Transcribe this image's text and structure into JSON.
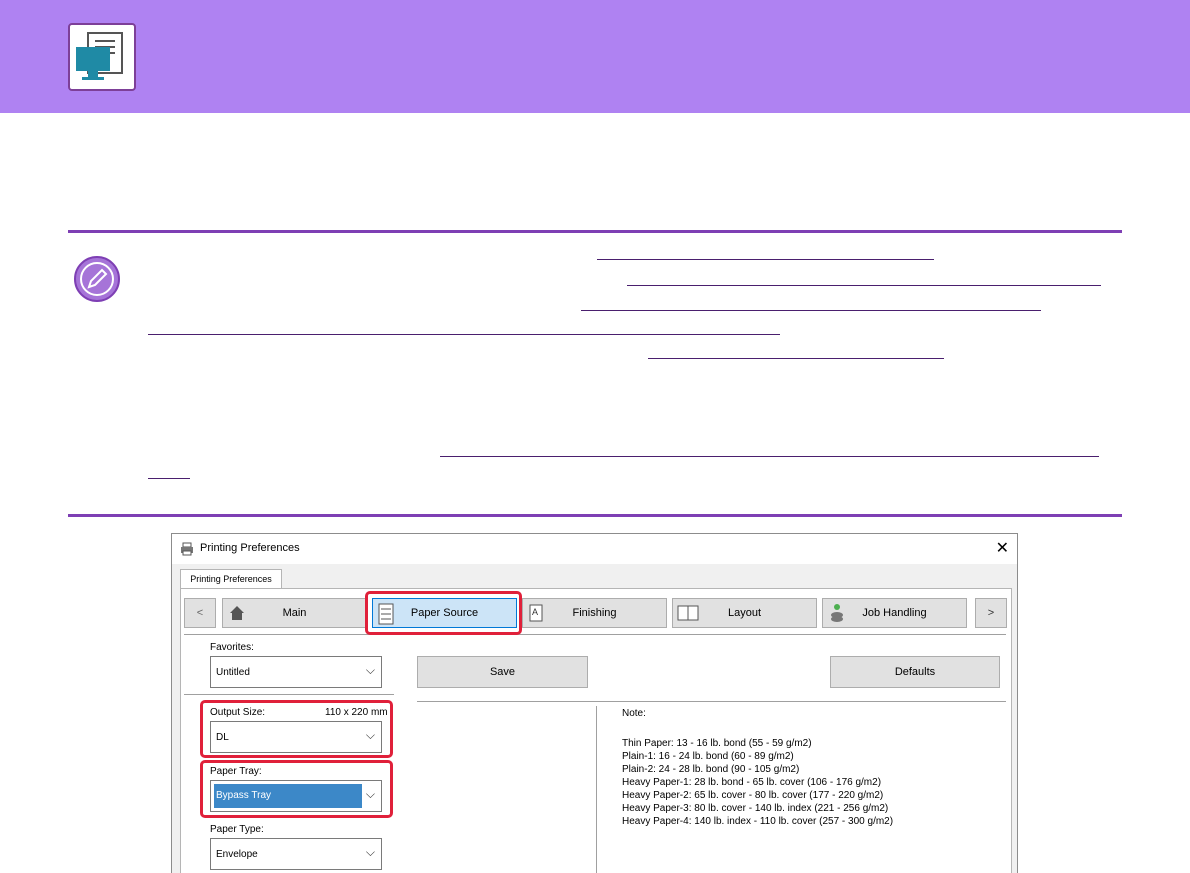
{
  "dialog": {
    "title": "Printing Preferences",
    "close": "✕",
    "tab_label": "Printing Preferences",
    "nav": {
      "prev": "<",
      "next": ">",
      "main": "Main",
      "paper_source": "Paper Source",
      "finishing": "Finishing",
      "layout": "Layout",
      "job_handling": "Job Handling"
    },
    "favorites_label": "Favorites:",
    "favorites_value": "Untitled",
    "save": "Save",
    "defaults": "Defaults",
    "output_size_label": "Output Size:",
    "output_size_dims": "110 x 220 mm",
    "output_size_value": "DL",
    "paper_tray_label": "Paper Tray:",
    "paper_tray_value": "Bypass Tray",
    "paper_type_label": "Paper Type:",
    "paper_type_value": "Envelope",
    "note_title": "Note:",
    "note_lines": [
      "Thin Paper: 13 - 16 lb. bond (55 - 59 g/m2)",
      "Plain-1: 16 - 24 lb. bond (60 - 89 g/m2)",
      "Plain-2: 24 - 28 lb. bond (90 - 105 g/m2)",
      "Heavy Paper-1: 28 lb. bond - 65 lb. cover (106 - 176 g/m2)",
      "Heavy Paper-2: 65 lb. cover - 80 lb. cover (177 - 220 g/m2)",
      "Heavy Paper-3: 80 lb. cover - 140 lb. index (221 - 256 g/m2)",
      "Heavy Paper-4: 140 lb. index - 110 lb. cover (257 - 300 g/m2)"
    ]
  },
  "icons": {
    "banner": "computer-document-icon",
    "note": "pencil-icon",
    "window": "printer-icon"
  },
  "colors": {
    "banner": "#af82f2",
    "rule": "#7e3fb4",
    "highlight": "#e0203a",
    "selection": "#3c88c8"
  }
}
